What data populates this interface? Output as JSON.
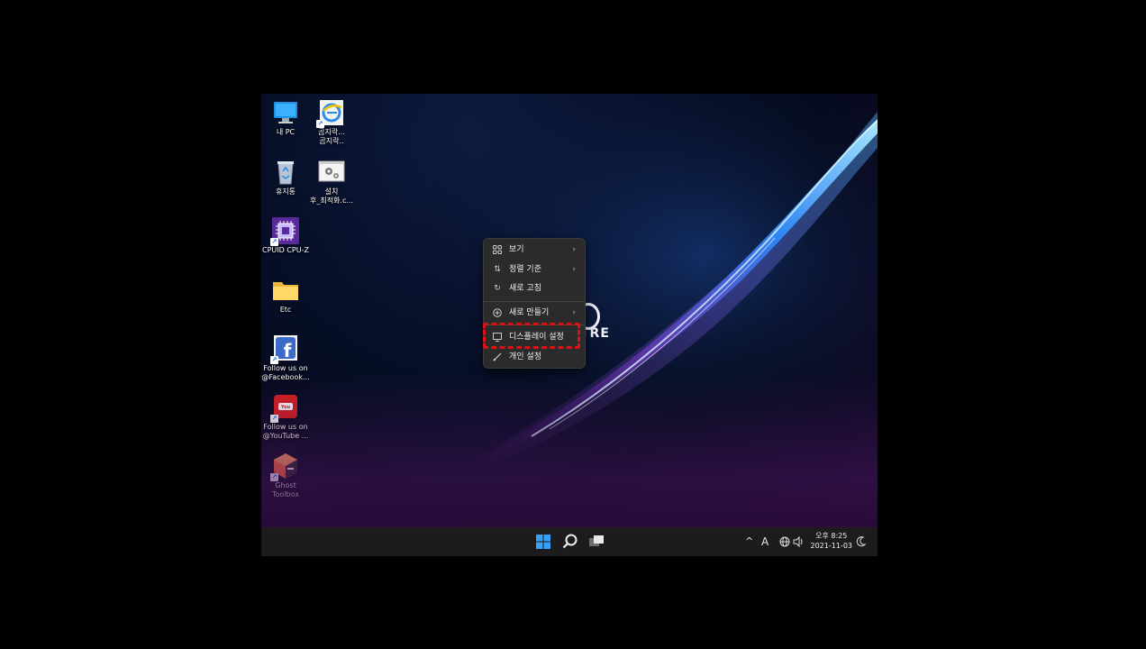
{
  "desktop": {
    "icons": [
      {
        "label": "내 PC",
        "icon": "computer-icon",
        "shortcut": false
      },
      {
        "label": "곰지락...\n곰지락..",
        "icon": "internet-explorer-icon",
        "shortcut": true
      },
      {
        "label": "휴지통",
        "icon": "recycle-bin-icon",
        "shortcut": false
      },
      {
        "label": "설치\n후_최적화.c...",
        "icon": "settings-gear-icon",
        "shortcut": false
      },
      {
        "label": "CPUID CPU-Z",
        "icon": "cpu-chip-icon",
        "shortcut": true
      },
      {
        "label": "Etc",
        "icon": "folder-icon",
        "shortcut": false
      },
      {
        "label": "Follow us on\n@Facebook...",
        "icon": "facebook-icon",
        "shortcut": true
      },
      {
        "label": "Follow us on\n@YouTube ...",
        "icon": "youtube-icon",
        "shortcut": true
      },
      {
        "label": "Ghost\nToolbox",
        "icon": "ghost-toolbox-icon",
        "shortcut": true
      }
    ],
    "brand_text": "TRE"
  },
  "context_menu": {
    "items": [
      {
        "label": "보기",
        "icon": "view-grid-icon",
        "submenu": true
      },
      {
        "label": "정렬 기준",
        "icon": "sort-icon",
        "submenu": true
      },
      {
        "label": "새로 고침",
        "icon": "refresh-icon",
        "submenu": false
      },
      {
        "label": "새로 만들기",
        "icon": "new-plus-icon",
        "submenu": true
      },
      {
        "label": "디스플레이 설정",
        "icon": "display-icon",
        "submenu": false,
        "highlighted": true
      },
      {
        "label": "개인 설정",
        "icon": "brush-icon",
        "submenu": false
      }
    ]
  },
  "taskbar": {
    "buttons": [
      "start-icon",
      "search-icon",
      "task-view-icon"
    ],
    "tray": {
      "chevron": "^",
      "ime": "A",
      "network_icon": "globe-icon",
      "volume_icon": "speaker-icon",
      "time": "오후 8:25",
      "date": "2021-11-03",
      "notification_icon": "moon-icon"
    }
  },
  "colors": {
    "highlight_border": "#e01010",
    "taskbar_bg": "#1c1c1f",
    "menu_bg": "#2b2b2b"
  }
}
